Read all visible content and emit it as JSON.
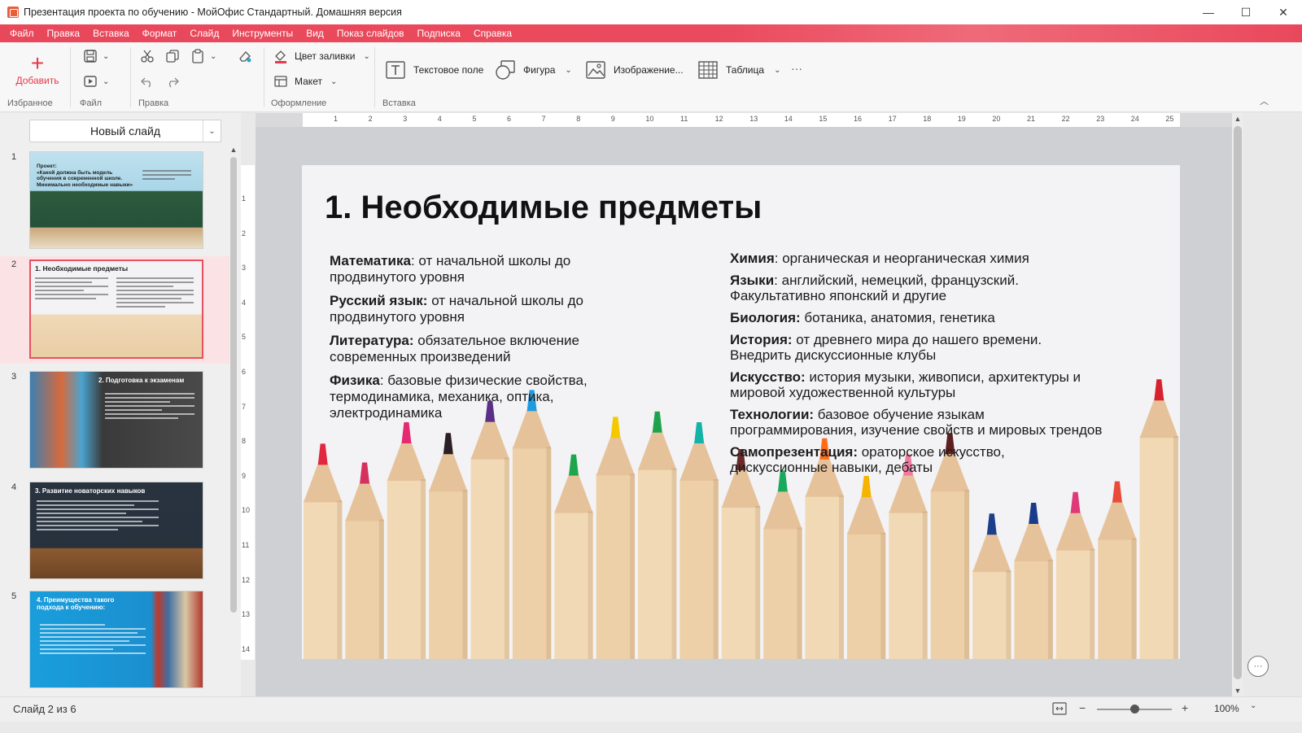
{
  "window": {
    "title": "Презентация проекта по обучению - МойОфис Стандартный. Домашняя версия",
    "minimize": "—",
    "maximize": "☐",
    "close": "✕"
  },
  "menu": [
    "Файл",
    "Правка",
    "Вставка",
    "Формат",
    "Слайд",
    "Инструменты",
    "Вид",
    "Показ слайдов",
    "Подписка",
    "Справка"
  ],
  "ribbon": {
    "add_label": "Добавить",
    "add_icon": "+",
    "groups": {
      "favorites": "Избранное",
      "file": "Файл",
      "edit": "Правка",
      "design": "Оформление",
      "insert": "Вставка"
    },
    "fill_color": "Цвет заливки",
    "layout": "Макет",
    "text_field": "Текстовое поле",
    "shape": "Фигура",
    "image": "Изображение...",
    "table": "Таблица",
    "more": "···"
  },
  "slide_panel": {
    "new_slide": "Новый слайд",
    "thumbnails": [
      {
        "num": "1",
        "title": "Проект:\n«Какой должна быть модель обучения в современной школе. Минимально необходимые навыки»"
      },
      {
        "num": "2",
        "title": "1. Необходимые предметы"
      },
      {
        "num": "3",
        "title": "2. Подготовка к экзаменам"
      },
      {
        "num": "4",
        "title": "3. Развитие новаторских навыков"
      },
      {
        "num": "5",
        "title": "4. Преимущества такого подхода к обучению:"
      }
    ]
  },
  "rulers": {
    "h": [
      "1",
      "2",
      "3",
      "4",
      "5",
      "6",
      "7",
      "8",
      "9",
      "10",
      "11",
      "12",
      "13",
      "14",
      "15",
      "16",
      "17",
      "18",
      "19",
      "20",
      "21",
      "22",
      "23",
      "24",
      "25"
    ],
    "v": [
      "1",
      "2",
      "3",
      "4",
      "5",
      "6",
      "7",
      "8",
      "9",
      "10",
      "11",
      "12",
      "13",
      "14"
    ]
  },
  "slide": {
    "title": "1. Необходимые предметы",
    "left": [
      {
        "term": "Математика",
        "sep": ":",
        "text": " от начальной школы до продвинутого уровня"
      },
      {
        "term": "Русский язык:",
        "sep": "",
        "text": " от начальной школы до продвинутого уровня"
      },
      {
        "term": "Литература:",
        "sep": "",
        "text": " обязательное включение современных произведений"
      },
      {
        "term": "Физика",
        "sep": ":",
        "text": " базовые физические свойства, термодинамика, механика, оптика, электродинамика"
      }
    ],
    "right": [
      {
        "term": "Химия",
        "sep": ":",
        "text": " органическая и неорганическая химия"
      },
      {
        "term": "Языки",
        "sep": ":",
        "text": " английский, немецкий, французский. Факультативно японский и другие"
      },
      {
        "term": "Биология:",
        "sep": "",
        "text": " ботаника, анатомия, генетика"
      },
      {
        "term": "История:",
        "sep": "",
        "text": " от древнего мира до нашего времени. Внедрить дискуссионные клубы"
      },
      {
        "term": "Искусство:",
        "sep": "",
        "text": " история музыки, живописи, архитектуры и мировой художественной культуры"
      },
      {
        "term": "Технологии:",
        "sep": "",
        "text": " базовое обучение языкам программирования, изучение свойств и мировых трендов"
      },
      {
        "term": "Самопрезентация:",
        "sep": "",
        "text": " ораторское искусство, дискуссионные навыки, дебаты"
      }
    ],
    "pencil_colors": [
      "#e0283f",
      "#d6305d",
      "#e52a72",
      "#2a1f24",
      "#5a2f88",
      "#1f9be0",
      "#1da64a",
      "#f5c900",
      "#1ea34c",
      "#13b3a8",
      "#6a2a2a",
      "#19a95d",
      "#ff6a1a",
      "#f4b400",
      "#f07aa0",
      "#5c2020",
      "#1c3f8c",
      "#1a3a8a",
      "#de3a7a",
      "#ea4a3a",
      "#d8202f"
    ]
  },
  "status": {
    "slide_counter": "Слайд 2 из 6",
    "zoom_minus": "−",
    "zoom_plus": "+",
    "zoom": "100%",
    "zoom_level": 0.5
  },
  "colors": {
    "accent": "#e9485b",
    "selected_slide_bg": "#fbe3e5"
  }
}
